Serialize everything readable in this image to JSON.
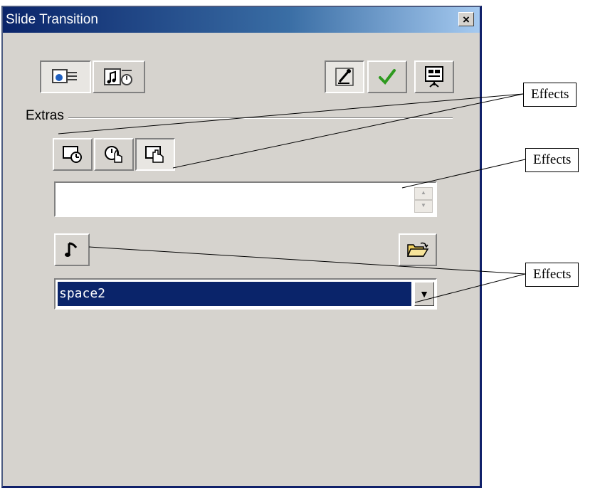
{
  "dialog": {
    "title": "Slide Transition",
    "close_glyph": "×"
  },
  "toolbar_top": {
    "left_buttons": [
      {
        "icon": "slide-effects-icon",
        "pressed": true
      },
      {
        "icon": "sound-timing-icon",
        "pressed": false
      }
    ],
    "right_buttons": [
      {
        "icon": "preview-icon",
        "pressed": true
      },
      {
        "icon": "apply-checkmark-icon",
        "pressed": false
      },
      {
        "icon": "slide-show-icon",
        "pressed": false
      }
    ]
  },
  "extras": {
    "label": "Extras",
    "mode_buttons": [
      {
        "icon": "automatic-timing-icon",
        "pressed": false
      },
      {
        "icon": "semi-automatic-icon",
        "pressed": false
      },
      {
        "icon": "manual-click-icon",
        "pressed": true
      }
    ],
    "time_field": {
      "value": ""
    },
    "sound_button_icon": "music-note-icon",
    "open_folder_icon": "open-folder-icon",
    "sound_select": {
      "value": "space2"
    }
  },
  "callouts": [
    "Effects",
    "Effects",
    "Effects"
  ],
  "colors": {
    "title_bar_start": "#0a246a",
    "panel_bg": "#d6d3ce",
    "selection_bg": "#0a246a",
    "check_green": "#2e9a1f"
  }
}
